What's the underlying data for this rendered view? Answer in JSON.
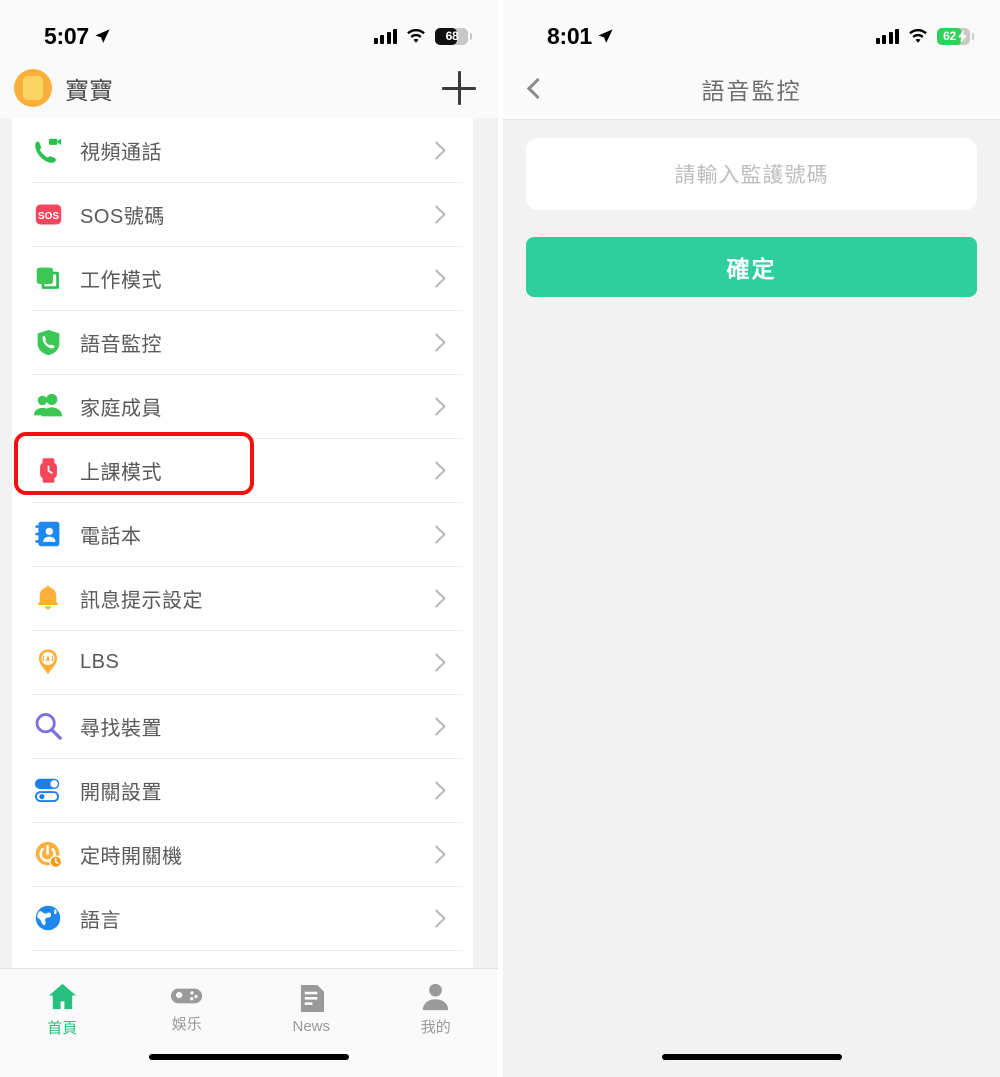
{
  "left": {
    "status": {
      "time": "5:07",
      "battery_pct": "68",
      "battery_charging": false,
      "location_icon": "location-arrow-icon",
      "signal_icon": "cellular-signal-icon",
      "wifi_icon": "wifi-icon"
    },
    "header": {
      "profile_name": "寶寶",
      "avatar_icon": "watch-avatar-icon",
      "add_label": "+"
    },
    "menu": [
      {
        "label": "視頻通話",
        "icon": "video-call-icon"
      },
      {
        "label": "SOS號碼",
        "icon": "sos-icon"
      },
      {
        "label": "工作模式",
        "icon": "work-mode-icon"
      },
      {
        "label": "語音監控",
        "icon": "voice-monitor-icon",
        "highlighted": true
      },
      {
        "label": "家庭成員",
        "icon": "family-members-icon"
      },
      {
        "label": "上課模式",
        "icon": "class-mode-watch-icon"
      },
      {
        "label": "電話本",
        "icon": "phonebook-icon"
      },
      {
        "label": "訊息提示設定",
        "icon": "bell-icon"
      },
      {
        "label": "LBS",
        "icon": "lbs-pin-icon"
      },
      {
        "label": "尋找裝置",
        "icon": "find-device-search-icon"
      },
      {
        "label": "開關設置",
        "icon": "switch-settings-icon"
      },
      {
        "label": "定時開關機",
        "icon": "scheduled-power-icon"
      },
      {
        "label": "語言",
        "icon": "globe-icon"
      }
    ],
    "tabs": [
      {
        "label": "首頁",
        "icon": "home-icon",
        "active": true
      },
      {
        "label": "娛乐",
        "icon": "gamepad-icon",
        "active": false
      },
      {
        "label": "News",
        "icon": "news-icon",
        "active": false
      },
      {
        "label": "我的",
        "icon": "person-icon",
        "active": false
      }
    ]
  },
  "right": {
    "status": {
      "time": "8:01",
      "battery_pct": "62",
      "battery_charging": true,
      "location_icon": "location-arrow-icon",
      "signal_icon": "cellular-signal-icon",
      "wifi_icon": "wifi-icon"
    },
    "nav": {
      "title": "語音監控",
      "back_icon": "back-chevron-icon"
    },
    "form": {
      "input_placeholder": "請輸入監護號碼",
      "input_value": "",
      "submit_label": "確定"
    }
  },
  "colors": {
    "accent_green": "#2ecf9c",
    "highlight_red": "#f60f0f",
    "tab_active": "#27c07c",
    "avatar_orange": "#fbb03b"
  }
}
